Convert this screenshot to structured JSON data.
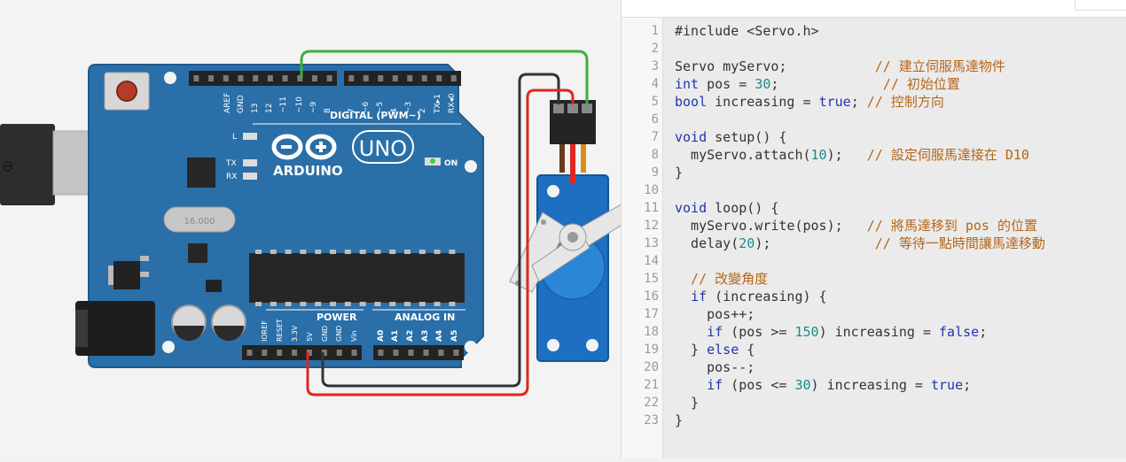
{
  "circuit": {
    "usb_symbol": "⊖",
    "board_logo": "ARDUINO",
    "board_model": "UNO",
    "digital_label": "DIGITAL (PWM~)",
    "power_label": "POWER",
    "analog_label": "ANALOG IN",
    "on_label": "ON",
    "led_labels": [
      "L",
      "TX",
      "RX"
    ],
    "digital_pins": [
      "AREF",
      "GND",
      "13",
      "12",
      "~11",
      "~10",
      "~9",
      "8",
      "7",
      "~6",
      "~5",
      "4",
      "~3",
      "2",
      "TX▸1",
      "RX◂0"
    ],
    "power_pins": [
      "IOREF",
      "RESET",
      "3.3V",
      "5V",
      "GND",
      "GND",
      "Vin"
    ],
    "analog_pins": [
      "A0",
      "A1",
      "A2",
      "A3",
      "A4",
      "A5"
    ],
    "crystal_label": "16.000",
    "colors": {
      "board": "#2a6fa8",
      "board_edge": "#1f5a8c",
      "wire_green": "#3cb13c",
      "wire_red": "#e0261f",
      "wire_black": "#333333",
      "servo_body": "#1d6fc1"
    }
  },
  "editor": {
    "lines": [
      [
        {
          "t": "#include <Servo.h>",
          "c": "txt"
        }
      ],
      [],
      [
        {
          "t": "Servo myServo;           ",
          "c": "txt"
        },
        {
          "t": "// 建立伺服馬達物件",
          "c": "cm"
        }
      ],
      [
        {
          "t": "int",
          "c": "kw"
        },
        {
          "t": " pos = ",
          "c": "txt"
        },
        {
          "t": "30",
          "c": "num"
        },
        {
          "t": ";             ",
          "c": "txt"
        },
        {
          "t": "// 初始位置",
          "c": "cm"
        }
      ],
      [
        {
          "t": "bool",
          "c": "kw"
        },
        {
          "t": " increasing = ",
          "c": "txt"
        },
        {
          "t": "true",
          "c": "kw"
        },
        {
          "t": "; ",
          "c": "txt"
        },
        {
          "t": "// 控制方向",
          "c": "cm"
        }
      ],
      [],
      [
        {
          "t": "void",
          "c": "kw"
        },
        {
          "t": " setup() {",
          "c": "txt"
        }
      ],
      [
        {
          "t": "  myServo.attach(",
          "c": "txt"
        },
        {
          "t": "10",
          "c": "num"
        },
        {
          "t": ");   ",
          "c": "txt"
        },
        {
          "t": "// 設定伺服馬達接在 D10",
          "c": "cm"
        }
      ],
      [
        {
          "t": "}",
          "c": "txt"
        }
      ],
      [],
      [
        {
          "t": "void",
          "c": "kw"
        },
        {
          "t": " loop() {",
          "c": "txt"
        }
      ],
      [
        {
          "t": "  myServo.write(pos);   ",
          "c": "txt"
        },
        {
          "t": "// 將馬達移到 pos 的位置",
          "c": "cm"
        }
      ],
      [
        {
          "t": "  delay(",
          "c": "txt"
        },
        {
          "t": "20",
          "c": "num"
        },
        {
          "t": ");             ",
          "c": "txt"
        },
        {
          "t": "// 等待一點時間讓馬達移動",
          "c": "cm"
        }
      ],
      [],
      [
        {
          "t": "  // 改變角度",
          "c": "cm"
        }
      ],
      [
        {
          "t": "  ",
          "c": "txt"
        },
        {
          "t": "if",
          "c": "kw"
        },
        {
          "t": " (increasing) {",
          "c": "txt"
        }
      ],
      [
        {
          "t": "    pos++;",
          "c": "txt"
        }
      ],
      [
        {
          "t": "    ",
          "c": "txt"
        },
        {
          "t": "if",
          "c": "kw"
        },
        {
          "t": " (pos >= ",
          "c": "txt"
        },
        {
          "t": "150",
          "c": "num"
        },
        {
          "t": ") increasing = ",
          "c": "txt"
        },
        {
          "t": "false",
          "c": "kw"
        },
        {
          "t": ";",
          "c": "txt"
        }
      ],
      [
        {
          "t": "  } ",
          "c": "txt"
        },
        {
          "t": "else",
          "c": "kw"
        },
        {
          "t": " {",
          "c": "txt"
        }
      ],
      [
        {
          "t": "    pos--;",
          "c": "txt"
        }
      ],
      [
        {
          "t": "    ",
          "c": "txt"
        },
        {
          "t": "if",
          "c": "kw"
        },
        {
          "t": " (pos <= ",
          "c": "txt"
        },
        {
          "t": "30",
          "c": "num"
        },
        {
          "t": ") increasing = ",
          "c": "txt"
        },
        {
          "t": "true",
          "c": "kw"
        },
        {
          "t": ";",
          "c": "txt"
        }
      ],
      [
        {
          "t": "  }",
          "c": "txt"
        }
      ],
      [
        {
          "t": "}",
          "c": "txt"
        }
      ]
    ]
  }
}
